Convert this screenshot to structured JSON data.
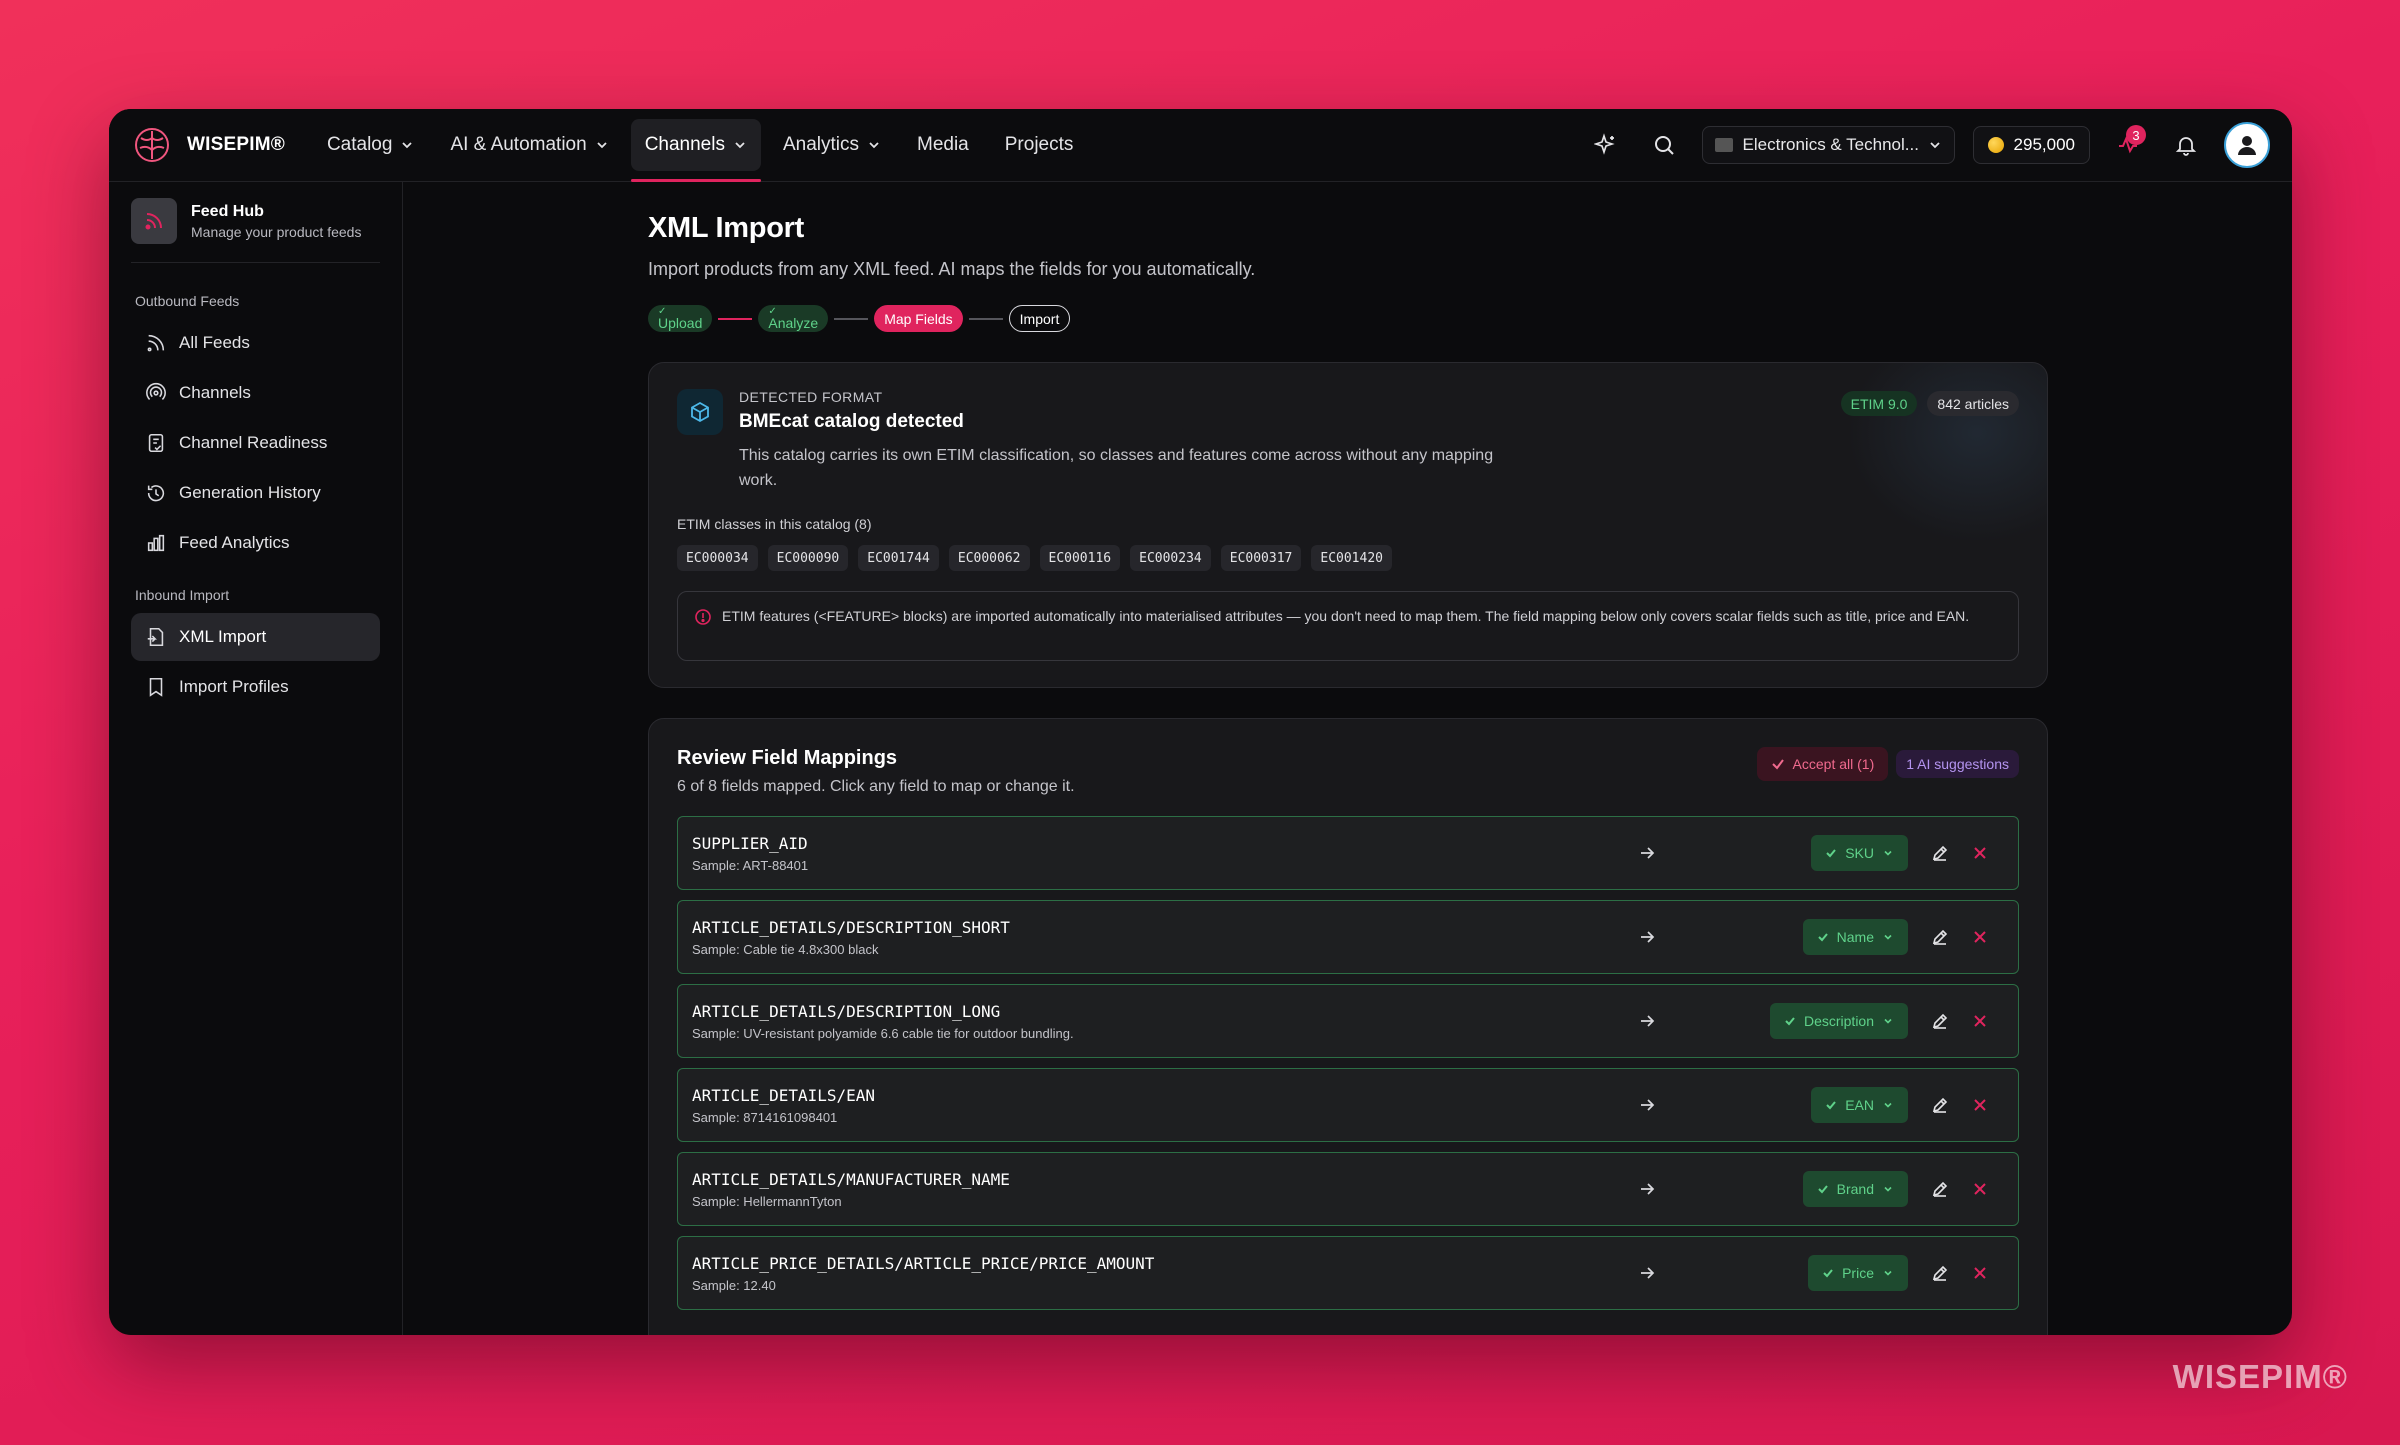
{
  "app": {
    "brand": "WISEPIM®"
  },
  "nav": {
    "items": [
      {
        "label": "Catalog",
        "dropdown": true
      },
      {
        "label": "AI & Automation",
        "dropdown": true
      },
      {
        "label": "Channels",
        "dropdown": true,
        "active": true
      },
      {
        "label": "Analytics",
        "dropdown": true
      },
      {
        "label": "Media",
        "dropdown": false
      },
      {
        "label": "Projects",
        "dropdown": false
      }
    ],
    "workspace": "Electronics & Technol...",
    "credits": "295,000",
    "alert_count": "3"
  },
  "sidebar": {
    "hub_title": "Feed Hub",
    "hub_subtitle": "Manage your product feeds",
    "outbound_label": "Outbound Feeds",
    "outbound_items": [
      "All Feeds",
      "Channels",
      "Channel Readiness",
      "Generation History",
      "Feed Analytics"
    ],
    "inbound_label": "Inbound Import",
    "inbound_items": [
      "XML Import",
      "Import Profiles"
    ]
  },
  "page": {
    "title": "XML Import",
    "subtitle": "Import products from any XML feed. AI maps the fields for you automatically.",
    "steps": [
      "Upload",
      "Analyze",
      "Map Fields",
      "Import"
    ]
  },
  "format": {
    "label": "DETECTED FORMAT",
    "title": "BMEcat catalog detected",
    "description": "This catalog carries its own ETIM classification, so classes and features come across without any mapping work.",
    "badge_etim": "ETIM 9.0",
    "badge_articles": "842 articles",
    "etim_label": "ETIM classes in this catalog (8)",
    "etim_codes": [
      "EC000034",
      "EC000090",
      "EC001744",
      "EC000062",
      "EC000116",
      "EC000234",
      "EC000317",
      "EC001420"
    ],
    "notice": "ETIM features (<FEATURE> blocks) are imported automatically into materialised attributes — you don't need to map them. The field mapping below only covers scalar fields such as title, price and EAN."
  },
  "mapping": {
    "title": "Review Field Mappings",
    "subtitle": "6 of 8 fields mapped. Click any field to map or change it.",
    "accept_all": "Accept all (1)",
    "ai_suggestions": "1 AI suggestions",
    "rows": [
      {
        "field": "SUPPLIER_AID",
        "sample": "Sample: ART-88401",
        "target": "SKU"
      },
      {
        "field": "ARTICLE_DETAILS/DESCRIPTION_SHORT",
        "sample": "Sample: Cable tie 4.8x300 black",
        "target": "Name"
      },
      {
        "field": "ARTICLE_DETAILS/DESCRIPTION_LONG",
        "sample": "Sample: UV-resistant polyamide 6.6 cable tie for outdoor bundling.",
        "target": "Description"
      },
      {
        "field": "ARTICLE_DETAILS/EAN",
        "sample": "Sample: 8714161098401",
        "target": "EAN"
      },
      {
        "field": "ARTICLE_DETAILS/MANUFACTURER_NAME",
        "sample": "Sample: HellermannTyton",
        "target": "Brand"
      },
      {
        "field": "ARTICLE_PRICE_DETAILS/ARTICLE_PRICE/PRICE_AMOUNT",
        "sample": "Sample: 12.40",
        "target": "Price"
      }
    ]
  },
  "watermark": "WISEPIM®",
  "colors": {
    "accent": "#e0245e",
    "success": "#5fd28a",
    "background": "#0b0b0d"
  }
}
